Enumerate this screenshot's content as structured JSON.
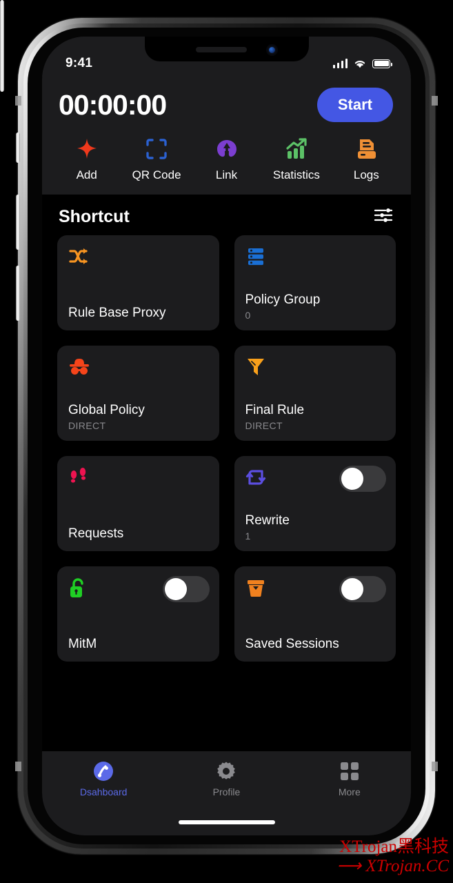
{
  "status_bar": {
    "time": "9:41",
    "signal_icon": "cellular-signal-icon",
    "wifi_icon": "wifi-icon",
    "battery_icon": "battery-full-icon"
  },
  "header": {
    "timer": "00:00:00",
    "start_label": "Start",
    "start_color": "#4457e4"
  },
  "quick_actions": [
    {
      "label": "Add",
      "icon": "sparkle-plus-icon",
      "color": "#f0391c"
    },
    {
      "label": "QR Code",
      "icon": "qr-scan-frame-icon",
      "color": "#2b61d1"
    },
    {
      "label": "Link",
      "icon": "link-download-icon",
      "color": "#7b3ed0"
    },
    {
      "label": "Statistics",
      "icon": "bar-chart-up-icon",
      "color": "#5cc167"
    },
    {
      "label": "Logs",
      "icon": "logs-document-icon",
      "color": "#f09035"
    }
  ],
  "section": {
    "title": "Shortcut",
    "filter_icon": "sliders-filter-icon"
  },
  "cards": [
    {
      "title": "Rule Base Proxy",
      "sub": "",
      "icon": "shuffle-arrows-icon",
      "color": "#f79421",
      "toggle": false
    },
    {
      "title": "Policy Group",
      "sub": "0",
      "icon": "server-stack-icon",
      "color": "#1a6fd4",
      "toggle": false
    },
    {
      "title": "Global Policy",
      "sub": "DIRECT",
      "icon": "incognito-hat-icon",
      "color": "#f5441a",
      "toggle": false
    },
    {
      "title": "Final Rule",
      "sub": "DIRECT",
      "icon": "funnel-filter-icon",
      "color": "#f9a01b",
      "toggle": false
    },
    {
      "title": "Requests",
      "sub": "",
      "icon": "footprints-icon",
      "color": "#ee1350",
      "toggle": false
    },
    {
      "title": "Rewrite",
      "sub": "1",
      "icon": "rewrite-loop-icon",
      "color": "#5b4ee0",
      "toggle": true
    },
    {
      "title": "MitM",
      "sub": "",
      "icon": "unlocked-padlock-icon",
      "color": "#1fcf24",
      "toggle": true
    },
    {
      "title": "Saved Sessions",
      "sub": "",
      "icon": "archive-box-icon",
      "color": "#f0811f",
      "toggle": true
    }
  ],
  "tabs": [
    {
      "label": "Dsahboard",
      "icon": "dashboard-globe-icon",
      "active": true
    },
    {
      "label": "Profile",
      "icon": "gear-icon",
      "active": false
    },
    {
      "label": "More",
      "icon": "grid-squares-icon",
      "active": false
    }
  ],
  "watermark": {
    "line1": "XTrojan黑科技",
    "line2": "⟶ XTrojan.CC"
  }
}
